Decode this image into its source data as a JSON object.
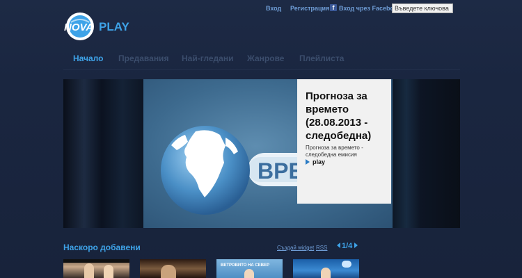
{
  "header": {
    "login": "Вход",
    "register": "Регистрация",
    "facebook_login": "Вход чрез Facebook",
    "search_placeholder": "Въведете ключова дума"
  },
  "logo": {
    "nova": "NOVA",
    "play": "PLAY"
  },
  "nav": {
    "items": [
      {
        "label": "Начало",
        "active": true
      },
      {
        "label": "Предавания"
      },
      {
        "label": "Най-гледани"
      },
      {
        "label": "Жанрове"
      },
      {
        "label": "Плейлиста"
      }
    ]
  },
  "featured": {
    "title": "Прогноза за времето (28.08.2013 - следобедна)",
    "description": "Прогноза за времето - следобедна емисия",
    "play_label": "play",
    "banner_text": "ВРЕМЕТО"
  },
  "recent": {
    "title": "Наскоро добавени",
    "create_widget": "Създай widget",
    "rss": "RSS",
    "page_current": "1",
    "page_total": "/4",
    "thumbs": [
      {
        "caption": ""
      },
      {
        "caption": ""
      },
      {
        "caption": "ВЕТРОВИТО НА СЕВЕР"
      },
      {
        "caption": ""
      }
    ]
  },
  "colors": {
    "accent": "#3ea3e8",
    "background": "#1a2640",
    "link": "#6f9dd6"
  }
}
